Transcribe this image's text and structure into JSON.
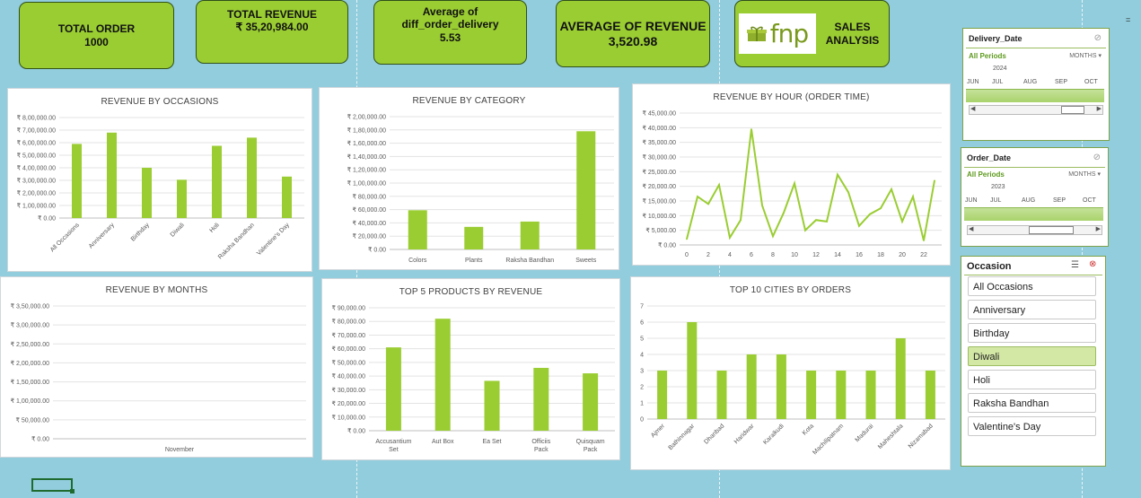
{
  "kpis": {
    "total_order": {
      "title": "TOTAL ORDER",
      "value": "1000"
    },
    "total_revenue": {
      "title": "TOTAL REVENUE",
      "value": "₹ 35,20,984.00"
    },
    "avg_delivery": {
      "title_l1": "Average of",
      "title_l2": "diff_order_delivery",
      "value": "5.53"
    },
    "avg_revenue": {
      "title": "AVERAGE OF REVENUE",
      "value": "3,520.98"
    },
    "brand": {
      "logo_text": "fnp",
      "title_l1": "SALES",
      "title_l2": "ANALYSIS"
    }
  },
  "colors": {
    "accent": "#9acd32",
    "bar": "#9acd32",
    "background": "#92cddd",
    "selected": "#d4e8a6"
  },
  "chart_data": [
    {
      "id": "occasions",
      "type": "bar",
      "title": "REVENUE BY OCCASIONS",
      "categories": [
        "All Occasions",
        "Anniversary",
        "Birthday",
        "Diwali",
        "Holi",
        "Raksha Bandhan",
        "Valentine's Day"
      ],
      "values": [
        590000,
        680000,
        400000,
        305000,
        575000,
        640000,
        330000
      ],
      "ylim": [
        0,
        800000
      ],
      "yticks": [
        "₹ 0.00",
        "₹ 1,00,000.00",
        "₹ 2,00,000.00",
        "₹ 3,00,000.00",
        "₹ 4,00,000.00",
        "₹ 5,00,000.00",
        "₹ 6,00,000.00",
        "₹ 7,00,000.00",
        "₹ 8,00,000.00"
      ]
    },
    {
      "id": "category",
      "type": "bar",
      "title": "REVENUE BY CATEGORY",
      "categories": [
        "Colors",
        "Plants",
        "Raksha Bandhan",
        "Sweets"
      ],
      "values": [
        59000,
        34000,
        42000,
        178000
      ],
      "ylim": [
        0,
        200000
      ],
      "yticks": [
        "₹ 0.00",
        "₹ 20,000.00",
        "₹ 40,000.00",
        "₹ 60,000.00",
        "₹ 80,000.00",
        "₹ 1,00,000.00",
        "₹ 1,20,000.00",
        "₹ 1,40,000.00",
        "₹ 1,60,000.00",
        "₹ 1,80,000.00",
        "₹ 2,00,000.00"
      ]
    },
    {
      "id": "hour",
      "type": "line",
      "title": "REVENUE BY HOUR (ORDER TIME)",
      "x": [
        0,
        1,
        2,
        3,
        4,
        5,
        6,
        7,
        8,
        9,
        10,
        11,
        12,
        13,
        14,
        15,
        16,
        17,
        18,
        19,
        20,
        21,
        22,
        23
      ],
      "values": [
        2000,
        16500,
        14000,
        20500,
        2500,
        8500,
        39500,
        13500,
        3000,
        11000,
        21000,
        5000,
        8500,
        8000,
        24000,
        18000,
        6500,
        10500,
        12500,
        19000,
        8000,
        16500,
        1500,
        22000
      ],
      "ylim": [
        0,
        45000
      ],
      "xticks": [
        "0",
        "2",
        "4",
        "6",
        "8",
        "10",
        "12",
        "14",
        "16",
        "18",
        "20",
        "22"
      ],
      "yticks": [
        "₹ 0.00",
        "₹ 5,000.00",
        "₹ 10,000.00",
        "₹ 15,000.00",
        "₹ 20,000.00",
        "₹ 25,000.00",
        "₹ 30,000.00",
        "₹ 35,000.00",
        "₹ 40,000.00",
        "₹ 45,000.00"
      ]
    },
    {
      "id": "months",
      "type": "bar",
      "title": "REVENUE BY MONTHS",
      "categories": [
        "November"
      ],
      "values": [
        0
      ],
      "ylim": [
        0,
        350000
      ],
      "yticks": [
        "₹ 0.00",
        "₹ 50,000.00",
        "₹ 1,00,000.00",
        "₹ 1,50,000.00",
        "₹ 2,00,000.00",
        "₹ 2,50,000.00",
        "₹ 3,00,000.00",
        "₹ 3,50,000.00"
      ]
    },
    {
      "id": "products",
      "type": "bar",
      "title": "TOP 5 PRODUCTS BY REVENUE",
      "categories": [
        "Accusantium Set",
        "Aut Box",
        "Ea Set",
        "Officiis Pack",
        "Quisquam Pack"
      ],
      "values": [
        61000,
        82000,
        36500,
        46000,
        42000
      ],
      "ylim": [
        0,
        90000
      ],
      "yticks": [
        "₹ 0.00",
        "₹ 10,000.00",
        "₹ 20,000.00",
        "₹ 30,000.00",
        "₹ 40,000.00",
        "₹ 50,000.00",
        "₹ 60,000.00",
        "₹ 70,000.00",
        "₹ 80,000.00",
        "₹ 90,000.00"
      ]
    },
    {
      "id": "cities",
      "type": "bar",
      "title": "TOP 10 CITIES BY ORDERS",
      "categories": [
        "Ajmer",
        "Bathinnagar",
        "Dhanbad",
        "Haridwar",
        "Karaikudi",
        "Kota",
        "Machilipatnam",
        "Madurai",
        "Maheshtala",
        "Nizamabad"
      ],
      "values": [
        3,
        6,
        3,
        4,
        4,
        3,
        3,
        3,
        5,
        3
      ],
      "ylim": [
        0,
        7
      ],
      "yticks": [
        "0",
        "1",
        "2",
        "3",
        "4",
        "5",
        "6",
        "7"
      ]
    }
  ],
  "slicers": {
    "delivery": {
      "title": "Delivery_Date",
      "all_periods": "All Periods",
      "mode": "MONTHS",
      "year": "2024",
      "months": [
        "JUN",
        "JUL",
        "AUG",
        "SEP",
        "OCT"
      ]
    },
    "order": {
      "title": "Order_Date",
      "all_periods": "All Periods",
      "mode": "MONTHS",
      "year": "2023",
      "months": [
        "JUN",
        "JUL",
        "AUG",
        "SEP",
        "OCT"
      ]
    },
    "occasion": {
      "title": "Occasion",
      "items": [
        "All Occasions",
        "Anniversary",
        "Birthday",
        "Diwali",
        "Holi",
        "Raksha Bandhan",
        "Valentine's Day"
      ],
      "selected": "Diwali"
    }
  },
  "sheet": {
    "equals_sign": "="
  }
}
